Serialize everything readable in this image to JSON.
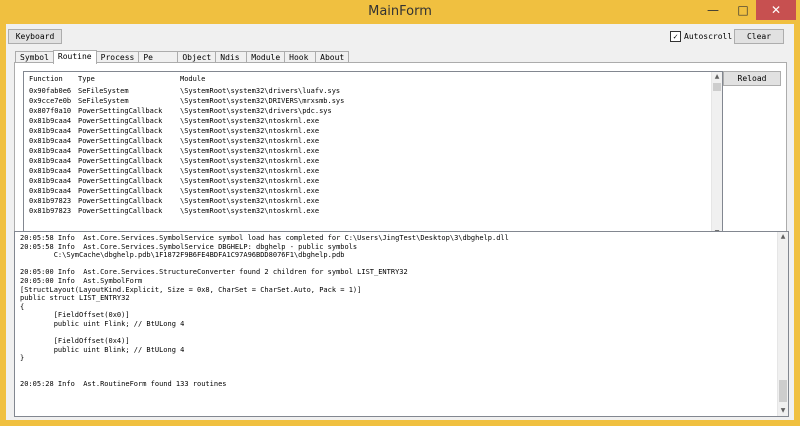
{
  "window": {
    "title": "MainForm",
    "minimize": "—",
    "maximize": "□",
    "close": "✕"
  },
  "toolbar": {
    "keyboard_label": "Keyboard",
    "autoscroll_label": "Autoscroll",
    "autoscroll_checked": "✓",
    "clear_label": "Clear"
  },
  "tabs": [
    {
      "label": "Symbol"
    },
    {
      "label": "Routine"
    },
    {
      "label": "Process"
    },
    {
      "label": "Pe"
    },
    {
      "label": "Object"
    },
    {
      "label": "Ndis"
    },
    {
      "label": "Module"
    },
    {
      "label": "Hook"
    },
    {
      "label": "About"
    }
  ],
  "routine": {
    "reload_label": "Reload",
    "headers": {
      "function": "Function",
      "type": "Type",
      "module": "Module"
    },
    "rows": [
      {
        "function": "0x90fab0e6",
        "type": "SeFileSystem",
        "module": "\\SystemRoot\\system32\\drivers\\luafv.sys"
      },
      {
        "function": "0x9cce7e0b",
        "type": "SeFileSystem",
        "module": "\\SystemRoot\\system32\\DRIVERS\\mrxsmb.sys"
      },
      {
        "function": "0x807f0a10",
        "type": "PowerSettingCallback",
        "module": "\\SystemRoot\\system32\\drivers\\pdc.sys"
      },
      {
        "function": "0x81b9caa4",
        "type": "PowerSettingCallback",
        "module": "\\SystemRoot\\system32\\ntoskrnl.exe"
      },
      {
        "function": "0x81b9caa4",
        "type": "PowerSettingCallback",
        "module": "\\SystemRoot\\system32\\ntoskrnl.exe"
      },
      {
        "function": "0x81b9caa4",
        "type": "PowerSettingCallback",
        "module": "\\SystemRoot\\system32\\ntoskrnl.exe"
      },
      {
        "function": "0x81b9caa4",
        "type": "PowerSettingCallback",
        "module": "\\SystemRoot\\system32\\ntoskrnl.exe"
      },
      {
        "function": "0x81b9caa4",
        "type": "PowerSettingCallback",
        "module": "\\SystemRoot\\system32\\ntoskrnl.exe"
      },
      {
        "function": "0x81b9caa4",
        "type": "PowerSettingCallback",
        "module": "\\SystemRoot\\system32\\ntoskrnl.exe"
      },
      {
        "function": "0x81b9caa4",
        "type": "PowerSettingCallback",
        "module": "\\SystemRoot\\system32\\ntoskrnl.exe"
      },
      {
        "function": "0x81b9caa4",
        "type": "PowerSettingCallback",
        "module": "\\SystemRoot\\system32\\ntoskrnl.exe"
      },
      {
        "function": "0x81b97823",
        "type": "PowerSettingCallback",
        "module": "\\SystemRoot\\system32\\ntoskrnl.exe"
      },
      {
        "function": "0x81b97823",
        "type": "PowerSettingCallback",
        "module": "\\SystemRoot\\system32\\ntoskrnl.exe"
      }
    ]
  },
  "log": [
    "20:05:58 Info  Ast.Core.Services.SymbolService symbol load has completed for C:\\Users\\JingTest\\Desktop\\3\\dbghelp.dll",
    "20:05:58 Info  Ast.Core.Services.SymbolService DBGHELP: dbghelp - public symbols",
    "        C:\\SymCache\\dbghelp.pdb\\1F1872F9B6FE4BDFA1C97A96BDD8076F1\\dbghelp.pdb",
    "",
    "20:05:00 Info  Ast.Core.Services.StructureConverter found 2 children for symbol LIST_ENTRY32",
    "20:05:00 Info  Ast.SymbolForm",
    "[StructLayout(LayoutKind.Explicit, Size = 0x8, CharSet = CharSet.Auto, Pack = 1)]",
    "public struct LIST_ENTRY32",
    "{",
    "        [FieldOffset(0x0)]",
    "        public uint Flink; // BtULong 4",
    "",
    "        [FieldOffset(0x4)]",
    "        public uint Blink; // BtULong 4",
    "}",
    "",
    "",
    "20:05:28 Info  Ast.RoutineForm found 133 routines"
  ],
  "icons": {
    "scroll_up": "▲",
    "scroll_down": "▼"
  }
}
